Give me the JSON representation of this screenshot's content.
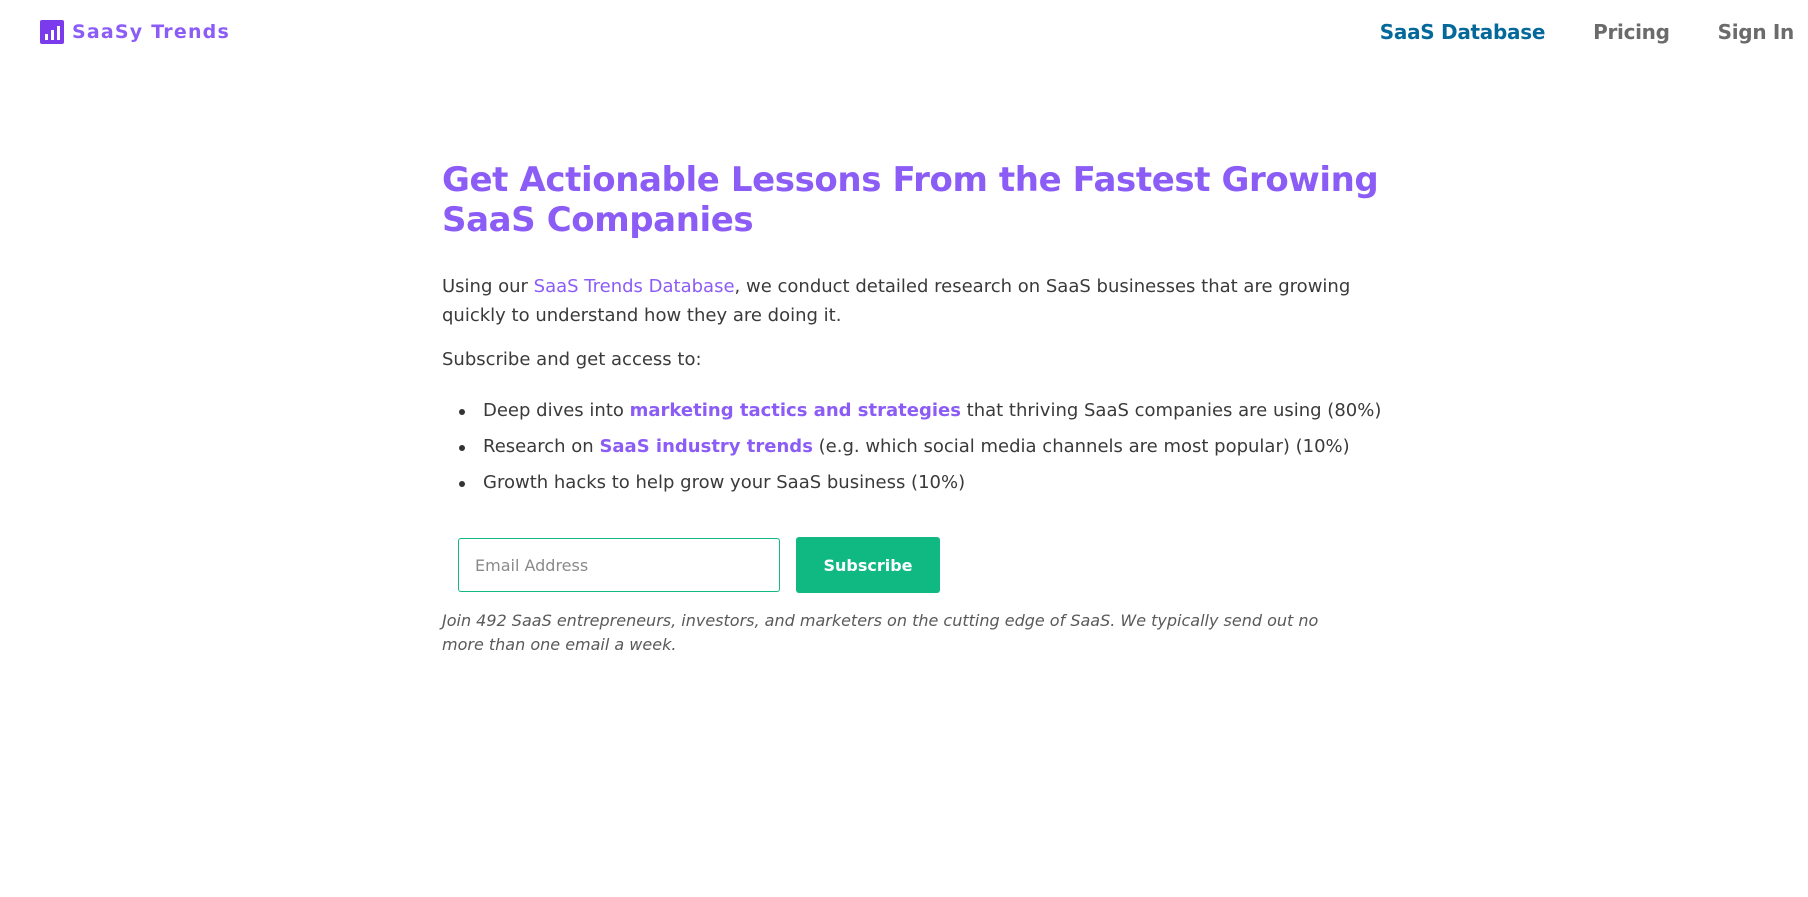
{
  "header": {
    "brand": "SaaSy Trends",
    "nav": {
      "database": "SaaS Database",
      "pricing": "Pricing",
      "sign_in": "Sign In"
    }
  },
  "hero": {
    "headline": "Get Actionable Lessons From the Fastest Growing SaaS Companies",
    "intro_prefix": "Using our ",
    "intro_link": "SaaS Trends Database",
    "intro_suffix": ", we conduct detailed research on SaaS businesses that are growing quickly to understand how they are doing it.",
    "subscribe_lead": "Subscribe and get access to:"
  },
  "benefits": [
    {
      "prefix": "Deep dives into ",
      "highlight": "marketing tactics and strategies",
      "suffix": " that thriving SaaS companies are using (80%)"
    },
    {
      "prefix": "Research on ",
      "highlight": "SaaS industry trends",
      "suffix": " (e.g. which social media channels are most popular) (10%)"
    },
    {
      "prefix": "Growth hacks to help grow your SaaS business (10%)",
      "highlight": "",
      "suffix": ""
    }
  ],
  "form": {
    "email_placeholder": "Email Address",
    "email_value": "",
    "button_label": "Subscribe",
    "footnote": "Join 492 SaaS entrepreneurs, investors, and marketers on the cutting edge of SaaS. We typically send out no more than one email a week."
  },
  "colors": {
    "brand_purple": "#8b5cf6",
    "nav_active_blue": "#04699a",
    "nav_gray": "#6b6b6b",
    "accent_green": "#10b981"
  },
  "icons": {
    "brand": "bar-chart-icon"
  }
}
